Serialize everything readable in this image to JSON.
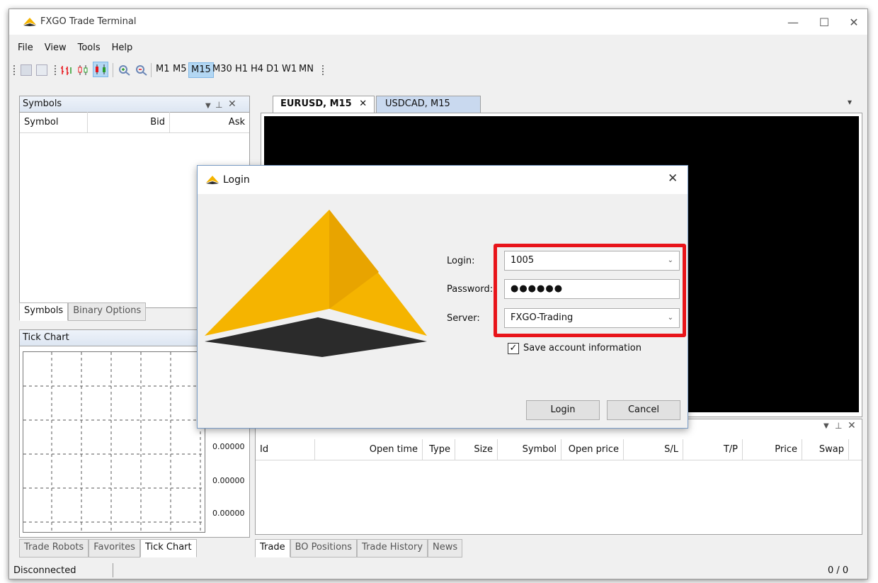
{
  "window": {
    "title": "FXGO Trade Terminal"
  },
  "menu": [
    "File",
    "View",
    "Tools",
    "Help"
  ],
  "toolbar": {
    "timeframes": [
      "M1",
      "M5",
      "M15",
      "M30",
      "H1",
      "H4",
      "D1",
      "W1",
      "MN"
    ],
    "selected_timeframe": "M15"
  },
  "symbols_panel": {
    "title": "Symbols",
    "pin": "📌",
    "columns": [
      "Symbol",
      "Bid",
      "Ask"
    ],
    "tabs": [
      "Symbols",
      "Binary Options"
    ]
  },
  "tick_chart_panel": {
    "title": "Tick Chart",
    "price_labels": [
      "0.00000",
      "0.00000",
      "0.00000"
    ],
    "tabs": [
      "Trade Robots",
      "Favorites",
      "Tick Chart"
    ]
  },
  "chart_tabs": [
    {
      "label": "EURUSD, M15",
      "close": "✕"
    },
    {
      "label": "USDCAD, M15"
    }
  ],
  "trade_panel": {
    "columns": [
      "Id",
      "Open time",
      "Type",
      "Size",
      "Symbol",
      "Open price",
      "S/L",
      "T/P",
      "Price",
      "Swap"
    ],
    "tabs": [
      "Trade",
      "BO Positions",
      "Trade History",
      "News"
    ]
  },
  "status_bar": {
    "status": "Disconnected",
    "counter": "0 / 0"
  },
  "login_dialog": {
    "title": "Login",
    "login_label": "Login:",
    "login_value": "1005",
    "password_label": "Password:",
    "password_value": "●●●●●●",
    "server_label": "Server:",
    "server_value": "FXGO-Trading",
    "save_label": "Save account information",
    "save_checked": true,
    "login_button": "Login",
    "cancel_button": "Cancel"
  },
  "colors": {
    "brand_yellow": "#f5b400",
    "brand_dark": "#2b2b2b",
    "highlight": "#e8141a",
    "chart_bg": "#000000"
  },
  "icons": [
    "app-logo-icon",
    "minimize-icon",
    "maximize-icon",
    "close-icon",
    "pin-icon",
    "dropdown-arrow-icon",
    "zoom-in-icon",
    "zoom-out-icon",
    "bar-chart-icon",
    "candle-chart-icon",
    "line-chart-icon",
    "checkbox-checked-icon"
  ]
}
